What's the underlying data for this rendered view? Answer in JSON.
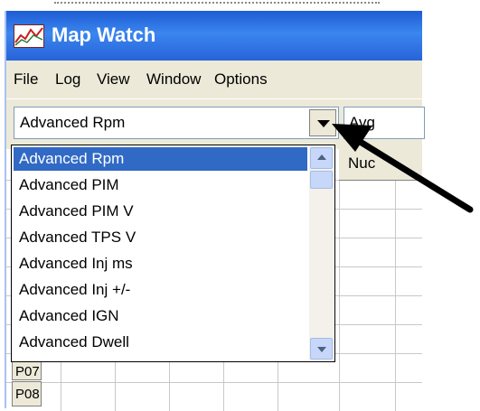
{
  "window": {
    "title": "Map Watch"
  },
  "menu": [
    "File",
    "Log",
    "View",
    "Window",
    "Options"
  ],
  "toolbar": {
    "combo_value": "Advanced Rpm",
    "combo2_value": "Avg"
  },
  "grid": {
    "header_partial": "Nuc",
    "row_headers": [
      "P07",
      "P08"
    ]
  },
  "dropdown": {
    "items": [
      "Advanced Rpm",
      "Advanced PIM",
      "Advanced PIM V",
      "Advanced TPS V",
      "Advanced Inj ms",
      "Advanced Inj +/-",
      "Advanced IGN",
      "Advanced Dwell"
    ],
    "selected_index": 0
  },
  "colors": {
    "title_bar": "#2863d8",
    "selection": "#316ac5",
    "annotation_arrow": "#000000"
  }
}
